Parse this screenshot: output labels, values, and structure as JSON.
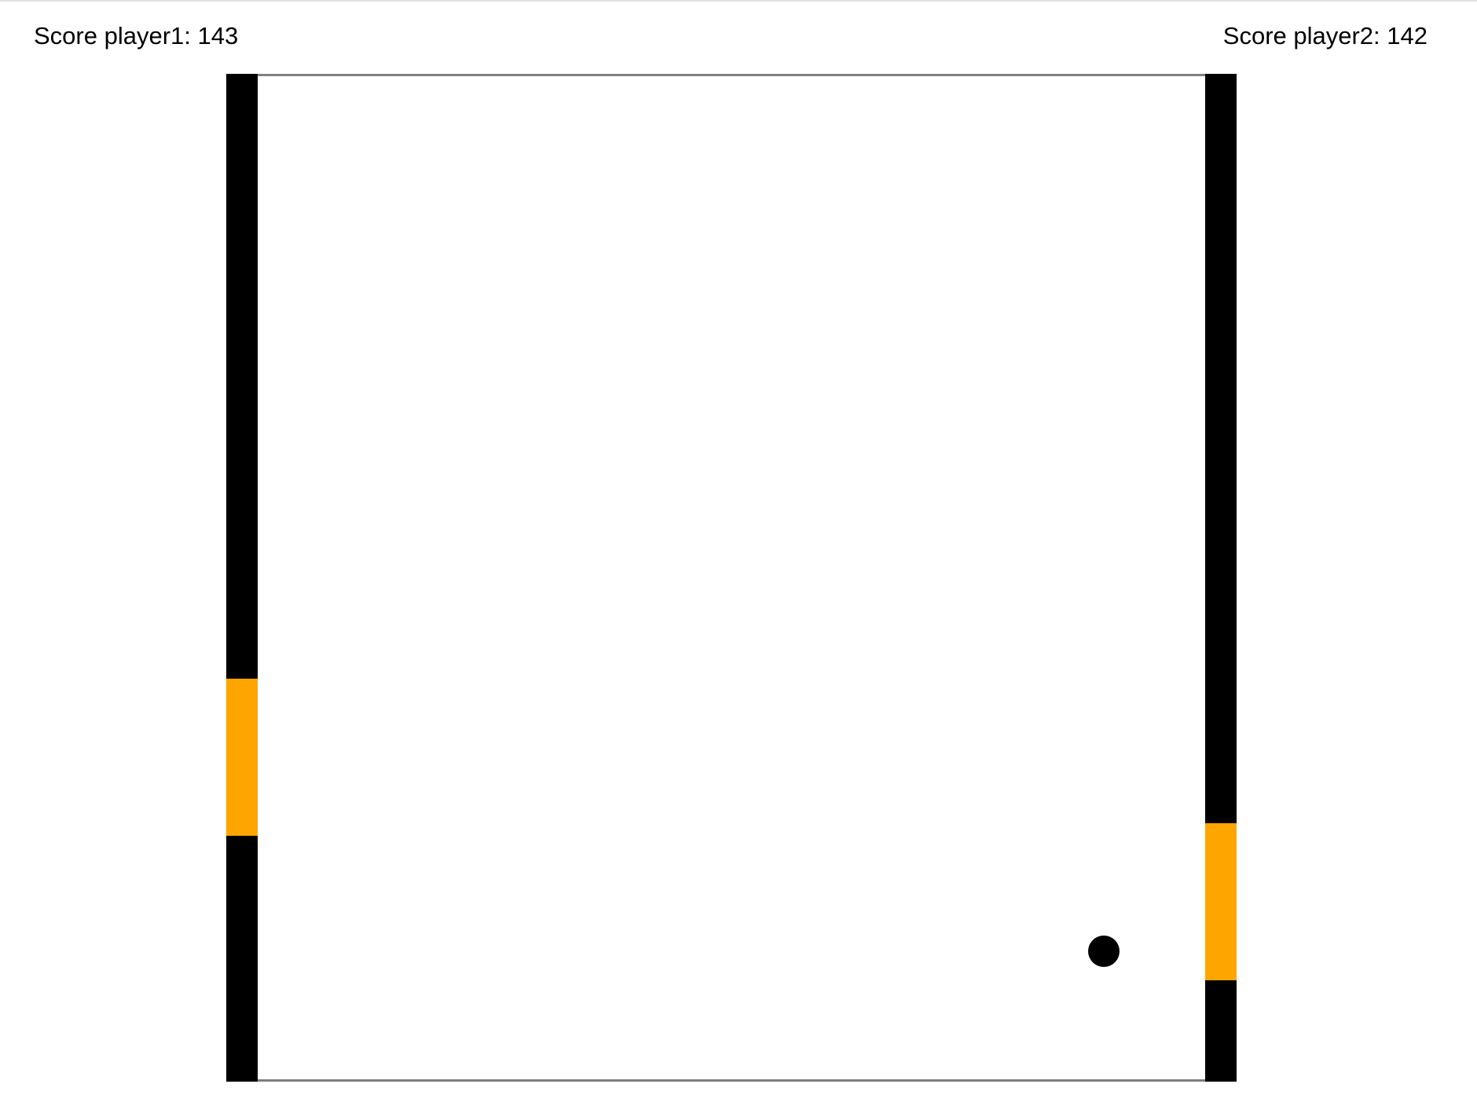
{
  "scoreboard": {
    "player1": "Score player1: 143",
    "player2": "Score player2: 142"
  },
  "colors": {
    "paddle": "#FFA500",
    "wall": "#000000",
    "ball": "#000000",
    "court_border": "#808080"
  }
}
